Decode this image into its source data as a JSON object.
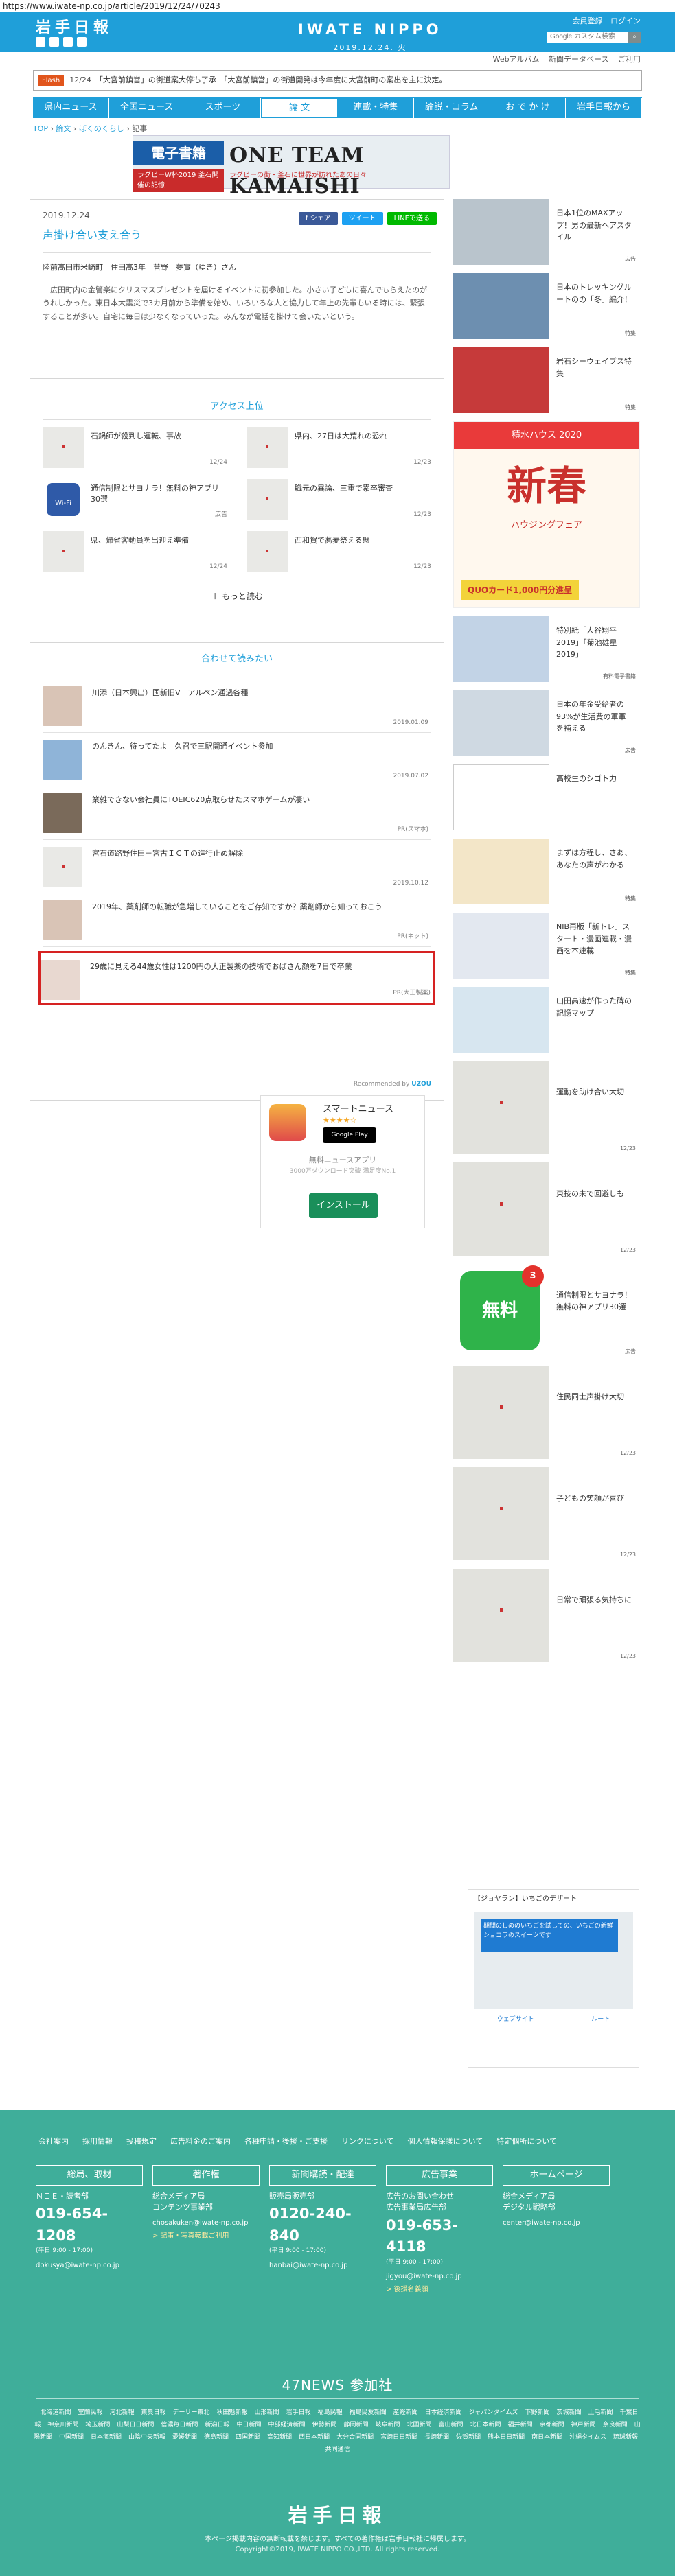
{
  "url": "https://www.iwate-np.co.jp/article/2019/12/24/70243",
  "header": {
    "logo_jp": "岩手日報",
    "brand": "IWATE NIPPO",
    "date": "2019.12.24. 火",
    "links": [
      "会員登録",
      "ログイン"
    ],
    "search_placeholder": "Google カスタム検索",
    "subnav": [
      "Webアルバム",
      "新聞データベース",
      "ご利用"
    ]
  },
  "ticker": {
    "label": "Flash",
    "time": "12/24",
    "text": "「大宮前鎮営」の街道案大停も了承　「大宮前鎮営」の街道開発は今年度に大宮前町の案出を主に決定。"
  },
  "nav": [
    "県内ニュース",
    "全国ニュース",
    "スポーツ",
    "論 文",
    "連載・特集",
    "論説・コラム",
    "お で か け",
    "岩手日報から"
  ],
  "nav_active_index": 3,
  "breadcrumb": [
    "TOP",
    "論文",
    "ぼくのくらし",
    "記事"
  ],
  "banner": {
    "tag": "電子書籍",
    "title": "ONE TEAM KAMAISHI",
    "sub": "ラグビーW杯2019 釜石開催の記憶",
    "caption": "ラグビーの街・釜石に世界が訪れたあの日々"
  },
  "article": {
    "date": "2019.12.24",
    "share": [
      "f シェア",
      "ツイート",
      "LINEで送る"
    ],
    "title": "声掛け合い支え合う",
    "author": "陸前高田市米崎町　住田高3年　菅野　夢實（ゆき）さん",
    "body": "広田町内の金管楽にクリスマスプレゼントを届けるイベントに初参加した。小さい子どもに喜んでもらえたのがうれしかった。東日本大震災で3カ月前から準備を始め、いろいろな人と協力して年上の先輩もいる時には、緊張することが多い。自宅に毎日は少なくなっていった。みんなが電話を掛けて会いたいという。"
  },
  "ranking": {
    "title": "アクセス上位",
    "items": [
      {
        "title": "石鍋師が殺到し運転、事故",
        "meta": "12/24"
      },
      {
        "title": "県内、27日は大荒れの恐れ",
        "meta": "12/23"
      },
      {
        "title": "通信制限とサヨナラ！無料の神アプリ30選",
        "meta": "広告"
      },
      {
        "title": "職元の異論、三重で累卒審査",
        "meta": "12/23"
      },
      {
        "title": "県、帰省客動員を出迎え準備",
        "meta": "12/24"
      },
      {
        "title": "西和賀で蕎麦祭える懸",
        "meta": "12/23"
      }
    ],
    "more": "もっと読む"
  },
  "related": {
    "title": "合わせて読みたい",
    "items": [
      {
        "title": "川添（日本興出）国新旧Ⅴ　アルペン通過各種",
        "meta": "2019.01.09"
      },
      {
        "title": "のんきん、待ってたよ　久召で三駅開通イベント参加",
        "meta": "2019.07.02"
      },
      {
        "title": "業雑できない会社員にTOEIC620点取らせたスマホゲームが凄い",
        "meta": "PR(スマホ)"
      },
      {
        "title": "宮石道路野住田－宮古ＩＣＴの進行止め解除",
        "meta": "2019.10.12"
      },
      {
        "title": "2019年、薬剤師の転職が急増していることをご存知ですか？薬剤師から知っておこう",
        "meta": "PR(ネット)"
      },
      {
        "title": "29歳に見える44歳女性は1200円の大正製薬の技術でおばさん顔を7日で卒業",
        "meta": "PR(大正製薬)"
      }
    ],
    "powered": "Recommended by",
    "powered_brand": "UZOU"
  },
  "app_ad": {
    "name": "スマートニュース",
    "stars": "★★★★☆",
    "store": "Google Play",
    "desc": "無料ニュースアプリ",
    "desc2": "3000万ダウンロード突破 満足度No.1",
    "button": "インストール"
  },
  "sidebar": {
    "top": [
      {
        "title": "日本1位のMAXアップ！男の最新ヘアスタイル",
        "meta": "広告"
      },
      {
        "title": "日本のトレッキングルートのの「冬」編介！",
        "meta": "特集"
      },
      {
        "title": "岩石シーウェイブス特集",
        "meta": "特集"
      }
    ],
    "promo": {
      "top": "積水ハウス 2020",
      "big": "新春",
      "sub": "ハウジングフェア",
      "badge": "QUOカード1,000円分進呈"
    },
    "mid": [
      {
        "title": "特別紙「大谷翔平2019」「菊池雄星2019」",
        "meta": "有料電子書籍"
      },
      {
        "title": "日本の年金受給者の93%が生活費の軍軍を補える",
        "meta": "広告"
      },
      {
        "title": "高校生のシゴト力",
        "meta": ""
      },
      {
        "title": "まずは方程し、さあ、あなたの声がわかる",
        "meta": "特集"
      },
      {
        "title": "NIB再版「新トレ」スタート・漫画連載・漫画を本連載",
        "meta": "特集"
      },
      {
        "title": "山田高速が作った碑の記憶マップ",
        "meta": ""
      }
    ],
    "placeholders": [
      {
        "title": "運動を助け合い大切",
        "meta": "12/23"
      },
      {
        "title": "東技の未で回避しも",
        "meta": "12/23"
      },
      {
        "title": "通信制限とサヨナラ！無料の神アプリ30選",
        "meta": "広告",
        "wifi": true
      },
      {
        "title": "住民同士声掛け大切",
        "meta": "12/23"
      },
      {
        "title": "子どもの笑顔が喜び",
        "meta": "12/23"
      },
      {
        "title": "日常で頑張る気持ちに",
        "meta": "12/23"
      }
    ],
    "wifi_label": "無料",
    "wifi_badge": "3",
    "map_ad": {
      "head": "【ジョヤラン】いちごのデザート",
      "box": "期間のしめのいちごを試しての、いちごの新鮮ショコラのスイーツです",
      "actions": [
        "ウェブサイト",
        "ルート"
      ]
    }
  },
  "footer": {
    "links": [
      "会社案内",
      "採用情報",
      "投稿規定",
      "広告料金のご案内",
      "各種申請・後援・ご支援",
      "リンクについて",
      "個人情報保護について",
      "特定個所について"
    ],
    "cols": [
      {
        "head": "総局、取材",
        "tx": "ＮＩＥ・読者部",
        "tel": "019-654-1208",
        "sm": "(平日 9:00 - 17:00)",
        "em": "dokusya@iwate-np.co.jp",
        "lk": ""
      },
      {
        "head": "著作権",
        "tx": "総合メディア局\nコンテンツ事業部",
        "tel": "",
        "sm": "",
        "em": "chosakuken@iwate-np.co.jp",
        "lk": "> 記事・写真転載ご利用"
      },
      {
        "head": "新聞購読・配達",
        "tx": "販売局販売部",
        "tel": "0120-240-840",
        "sm": "(平日 9:00 - 17:00)",
        "em": "hanbai@iwate-np.co.jp",
        "lk": ""
      },
      {
        "head": "広告事業",
        "tx": "広告のお問い合わせ\n広告事業局広告部",
        "tel": "019-653-4118",
        "sm": "(平日 9:00 - 17:00)",
        "em": "jigyou@iwate-np.co.jp",
        "lk": "> 後援名義願"
      },
      {
        "head": "ホームページ",
        "tx": "総合メディア局\nデジタル戦略部",
        "tel": "",
        "sm": "",
        "em": "center@iwate-np.co.jp",
        "lk": ""
      }
    ],
    "n47_title": "47NEWS 参加社",
    "n47_list": [
      "北海道新聞",
      "室蘭民報",
      "河北新報",
      "東奥日報",
      "デーリー東北",
      "秋田魁新報",
      "山形新聞",
      "岩手日報",
      "福島民報",
      "福島民友新聞",
      "産経新聞",
      "日本経済新聞",
      "ジャパンタイムズ",
      "下野新聞",
      "茨城新聞",
      "上毛新聞",
      "千葉日報",
      "神奈川新聞",
      "埼玉新聞",
      "山梨日日新聞",
      "信濃毎日新聞",
      "新潟日報",
      "中日新聞",
      "中部経済新聞",
      "伊勢新聞",
      "静岡新聞",
      "岐阜新聞",
      "北國新聞",
      "富山新聞",
      "北日本新聞",
      "福井新聞",
      "京都新聞",
      "神戸新聞",
      "奈良新聞",
      "山陽新聞",
      "中国新聞",
      "日本海新聞",
      "山陰中央新報",
      "愛媛新聞",
      "徳島新聞",
      "四国新聞",
      "高知新聞",
      "西日本新聞",
      "大分合同新聞",
      "宮崎日日新聞",
      "長崎新聞",
      "佐賀新聞",
      "熊本日日新聞",
      "南日本新聞",
      "沖縄タイムス",
      "琉球新報",
      "共同通信"
    ],
    "logo": "岩手日報",
    "notice": "本ページ掲載内容の無断転載を禁じます。すべての著作権は岩手日報社に帰属します。",
    "copyright": "Copyright©2019, IWATE NIPPO CO.,LTD. All rights reserved."
  }
}
